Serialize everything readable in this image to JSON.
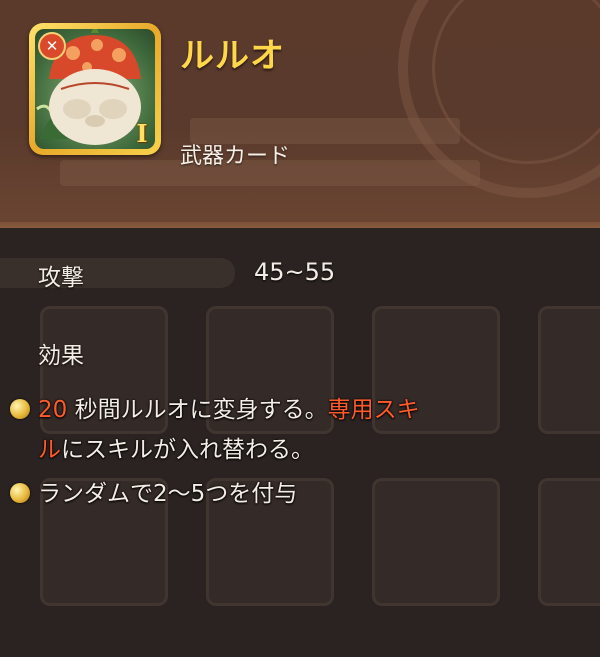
{
  "item": {
    "name": "ルルオ",
    "type": "武器カード",
    "rank": "I"
  },
  "stats": {
    "attack_label": "攻撃",
    "attack_value": "45~55"
  },
  "effects": {
    "label": "効果",
    "effect1": {
      "num": "20",
      "text1": " 秒間ルルオに変身する。",
      "hl1": "専用スキ",
      "hl2": "ル",
      "text2": "にスキルが入れ替わる。"
    },
    "effect2": {
      "text": "ランダムで2〜5つを付与"
    }
  },
  "colors": {
    "name": "#ffd84a",
    "highlight": "#ff5a2a",
    "text": "#f3ede6",
    "frame": "#f0b830"
  },
  "icons": [
    "sword-icon",
    "bullet-coin-icon"
  ]
}
